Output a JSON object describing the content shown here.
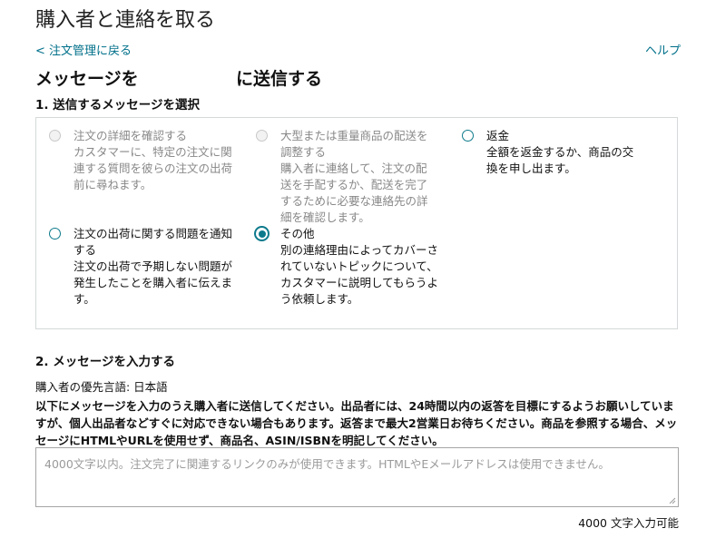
{
  "page": {
    "title": "購入者と連絡を取る",
    "back_link": "< 注文管理に戻る",
    "help_link": "ヘルプ",
    "heading_left": "メッセージを",
    "heading_right": "に送信する"
  },
  "step1": {
    "label": "1. 送信するメッセージを選択",
    "options": [
      {
        "title": "注文の詳細を確認する",
        "description": "カスタマーに、特定の注文に関連する質問を彼らの注文の出荷前に尋ねます。",
        "disabled": true,
        "selected": false
      },
      {
        "title": "大型または重量商品の配送を調整する",
        "description": "購入者に連絡して、注文の配送を手配するか、配送を完了するために必要な連絡先の詳細を確認します。",
        "disabled": true,
        "selected": false
      },
      {
        "title": "返金",
        "description": "全額を返金するか、商品の交換を申し出ます。",
        "disabled": false,
        "selected": false
      },
      {
        "title": "注文の出荷に関する問題を通知する",
        "description": "注文の出荷で予期しない問題が発生したことを購入者に伝えます。",
        "disabled": false,
        "selected": false
      },
      {
        "title": "その他",
        "description": "別の連絡理由によってカバーされていないトピックについて、カスタマーに説明してもらうよう依頼します。",
        "disabled": false,
        "selected": true
      }
    ]
  },
  "step2": {
    "label": "2. メッセージを入力する",
    "language_label": "購入者の優先言語: 日本語",
    "instructions": "以下にメッセージを入力のうえ購入者に送信してください。出品者には、24時間以内の返答を目標にするようお願いしていますが、個人出品者などすぐに対応できない場合もあります。返答まで最大2営業日お待ちください。商品を参照する場合、メッセージにHTMLやURLを使用せず、商品名、ASIN/ISBNを明記してください。",
    "message_value": "",
    "message_placeholder": "4000文字以内。注文完了に関連するリンクのみが使用できます。HTMLやEメールアドレスは使用できません。",
    "char_counter": "4000 文字入力可能"
  },
  "colors": {
    "accent": "#0d7a8c",
    "link": "#00708a",
    "disabled_text": "#888888",
    "border": "#d5d9d9"
  },
  "icons": {
    "resize_grip": "resize-grip-icon"
  }
}
